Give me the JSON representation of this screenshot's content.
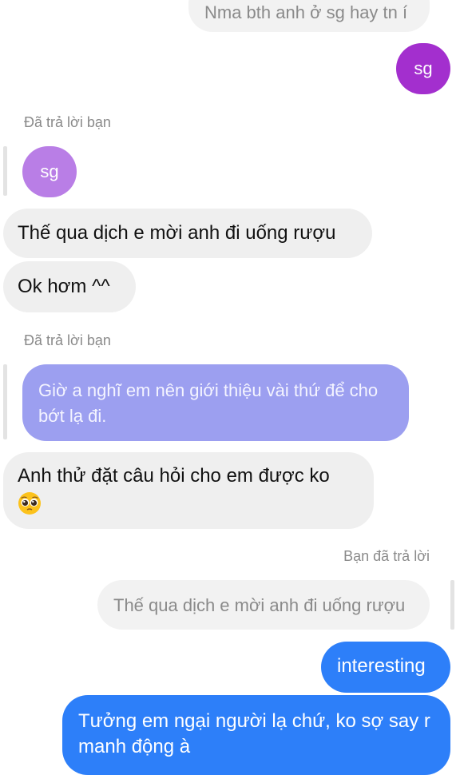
{
  "colors": {
    "received_bubble": "#efefef",
    "quoted_bubble": "#f2f2f2",
    "sent_purple": "#a32fce",
    "reply_purple_light": "#b97ee6",
    "reply_violet": "#9c9ff0",
    "sent_blue": "#2d7ff9",
    "meta_text": "#8a8a8a"
  },
  "messages": {
    "top_quote": "Nma bth anh ở sg hay tn í",
    "sent_sg": "sg",
    "reply_label_1": "Đã trả lời bạn",
    "reply_quote_1": "sg",
    "received_1": "Thế qua dịch e mời anh đi uống rượu",
    "received_2": "Ok hơm ^^",
    "reply_label_2": "Đã trả lời bạn",
    "reply_quote_2": "Giờ a nghĩ em nên giới thiệu vài thứ để cho bớt lạ đi.",
    "received_3": "Anh thử đặt câu hỏi cho em được ko",
    "received_3_emoji": "pleading-face-emoji",
    "reply_label_3": "Bạn đã trả lời",
    "reply_quote_3": "Thế qua dịch e mời anh đi uống rượu",
    "sent_1": "interesting",
    "sent_2": "Tưởng em ngại người lạ chứ, ko sợ say r manh động à"
  }
}
